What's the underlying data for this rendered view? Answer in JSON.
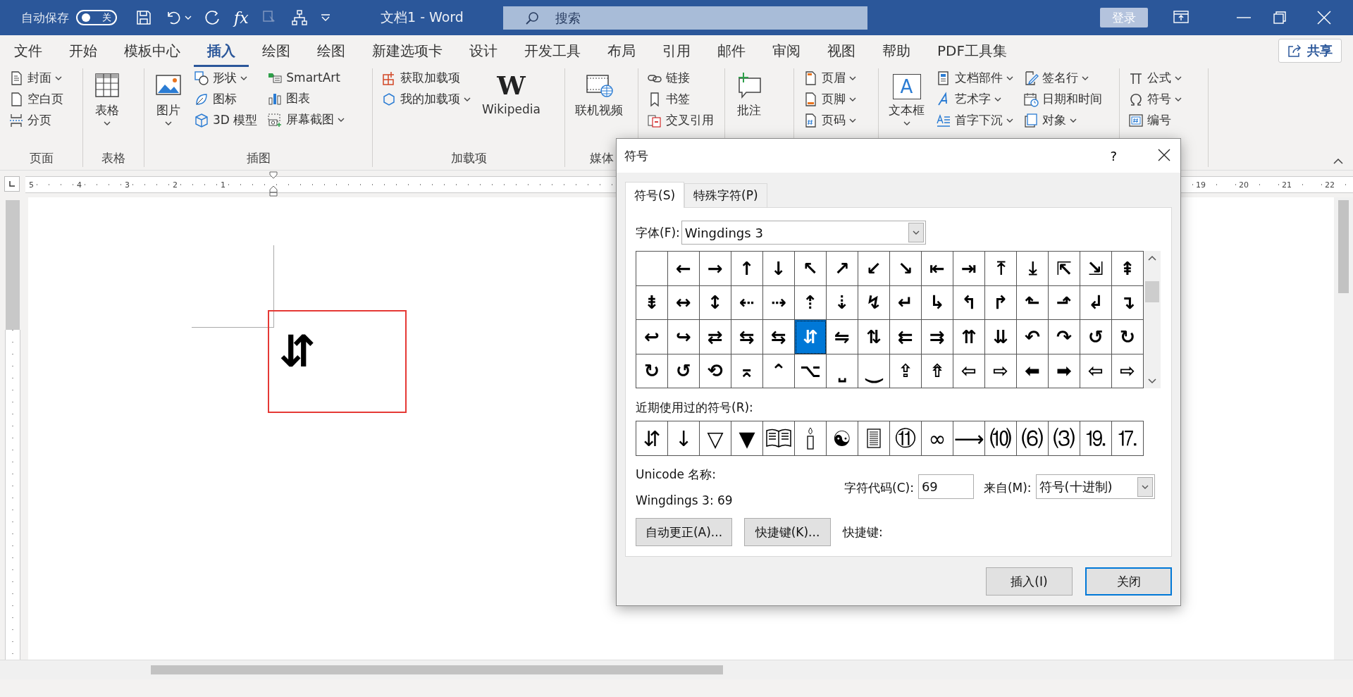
{
  "title_bar": {
    "autosave_label": "自动保存",
    "autosave_toggle": {
      "on": false,
      "label": "关"
    },
    "formula_button": "fx",
    "document_title": "文档1  -  Word",
    "search_placeholder": "搜索",
    "sign_in": "登录"
  },
  "ribbon_tabs": [
    {
      "label": "文件",
      "selected": false
    },
    {
      "label": "开始",
      "selected": false
    },
    {
      "label": "模板中心",
      "selected": false
    },
    {
      "label": "插入",
      "selected": true
    },
    {
      "label": "绘图",
      "selected": false
    },
    {
      "label": "绘图",
      "selected": false
    },
    {
      "label": "新建选项卡",
      "selected": false
    },
    {
      "label": "设计",
      "selected": false
    },
    {
      "label": "开发工具",
      "selected": false
    },
    {
      "label": "布局",
      "selected": false
    },
    {
      "label": "引用",
      "selected": false
    },
    {
      "label": "邮件",
      "selected": false
    },
    {
      "label": "审阅",
      "selected": false
    },
    {
      "label": "视图",
      "selected": false
    },
    {
      "label": "帮助",
      "selected": false
    },
    {
      "label": "PDF工具集",
      "selected": false
    }
  ],
  "share_button": "共享",
  "ribbon_groups": [
    {
      "label": "页面",
      "columns": [
        {
          "kind": "stack",
          "items": [
            {
              "label": "封面",
              "dropdown": true
            },
            {
              "label": "空白页",
              "dropdown": false
            },
            {
              "label": "分页",
              "dropdown": false
            }
          ]
        }
      ]
    },
    {
      "label": "表格",
      "columns": [
        {
          "kind": "large",
          "label": "表格",
          "dropdown": true
        }
      ]
    },
    {
      "label": "插图",
      "columns": [
        {
          "kind": "large",
          "label": "图片",
          "dropdown": true
        },
        {
          "kind": "stack",
          "items": [
            {
              "label": "形状",
              "dropdown": true
            },
            {
              "label": "图标",
              "dropdown": false
            },
            {
              "label": "3D 模型",
              "dropdown": false
            }
          ]
        },
        {
          "kind": "stack",
          "items": [
            {
              "label": "SmartArt",
              "dropdown": false
            },
            {
              "label": "图表",
              "dropdown": false
            },
            {
              "label": "屏幕截图",
              "dropdown": true
            }
          ]
        }
      ]
    },
    {
      "label": "加载项",
      "columns": [
        {
          "kind": "stack",
          "items": [
            {
              "label": "获取加载项",
              "dropdown": false
            },
            {
              "label": "我的加载项",
              "dropdown": true
            }
          ]
        },
        {
          "kind": "large",
          "label": "Wikipedia",
          "dropdown": false,
          "icon_text": "W"
        }
      ]
    },
    {
      "label": "媒体",
      "columns": [
        {
          "kind": "large",
          "label": "联机视频",
          "dropdown": false
        }
      ]
    },
    {
      "columns": [
        {
          "kind": "stack",
          "items": [
            {
              "label": "链接",
              "dropdown": false
            },
            {
              "label": "书签",
              "dropdown": false
            },
            {
              "label": "交叉引用",
              "dropdown": false
            }
          ]
        }
      ]
    },
    {
      "columns": [
        {
          "kind": "large",
          "label": "批注",
          "dropdown": false
        }
      ]
    },
    {
      "columns": [
        {
          "kind": "stack",
          "items": [
            {
              "label": "页眉",
              "dropdown": true
            },
            {
              "label": "页脚",
              "dropdown": true
            },
            {
              "label": "页码",
              "dropdown": true
            }
          ]
        }
      ]
    },
    {
      "columns": [
        {
          "kind": "large",
          "label": "文本框",
          "dropdown": true,
          "icon_text": "A"
        },
        {
          "kind": "stack",
          "items": [
            {
              "label": "文档部件",
              "dropdown": true
            },
            {
              "label": "艺术字",
              "dropdown": true
            },
            {
              "label": "首字下沉",
              "dropdown": true
            }
          ]
        },
        {
          "kind": "stack",
          "items": [
            {
              "label": "签名行",
              "dropdown": true
            },
            {
              "label": "日期和时间",
              "dropdown": false
            },
            {
              "label": "对象",
              "dropdown": true
            }
          ]
        }
      ]
    },
    {
      "columns": [
        {
          "kind": "stack",
          "items": [
            {
              "label": "公式",
              "dropdown": true
            },
            {
              "label": "符号",
              "dropdown": true
            },
            {
              "label": "编号",
              "dropdown": false
            }
          ]
        }
      ]
    }
  ],
  "ruler": {
    "left_numbers": [
      "5",
      "4",
      "3",
      "2",
      "1"
    ],
    "right_numbers": [
      "19",
      "20",
      "21",
      "22"
    ]
  },
  "document": {
    "inserted_symbol": "⇵"
  },
  "symbol_dialog": {
    "title": "符号",
    "help": "?",
    "tabs": [
      {
        "label": "符号(S)",
        "selected": true
      },
      {
        "label": "特殊字符(P)",
        "selected": false
      }
    ],
    "font_label": "字体(F):",
    "font_value": "Wingdings 3",
    "symbols": [
      {
        "selected": false
      },
      {
        "char": "←",
        "selected": false
      },
      {
        "char": "→",
        "selected": false
      },
      {
        "char": "↑",
        "selected": false
      },
      {
        "char": "↓",
        "selected": false
      },
      {
        "char": "↖",
        "selected": false
      },
      {
        "char": "↗",
        "selected": false
      },
      {
        "char": "↙",
        "selected": false
      },
      {
        "char": "↘",
        "selected": false
      },
      {
        "char": "⇤",
        "selected": false
      },
      {
        "char": "⇥",
        "selected": false
      },
      {
        "char": "⤒",
        "selected": false
      },
      {
        "char": "⤓",
        "selected": false
      },
      {
        "char": "⇱",
        "selected": false
      },
      {
        "char": "⇲",
        "selected": false
      },
      {
        "char": "⇞",
        "selected": false
      },
      {
        "char": "⇟",
        "selected": false
      },
      {
        "char": "↔",
        "selected": false
      },
      {
        "char": "↕",
        "selected": false
      },
      {
        "char": "⇠",
        "selected": false
      },
      {
        "char": "⇢",
        "selected": false
      },
      {
        "char": "⇡",
        "selected": false
      },
      {
        "char": "⇣",
        "selected": false
      },
      {
        "char": "↯",
        "selected": false
      },
      {
        "char": "↵",
        "selected": false
      },
      {
        "char": "↳",
        "selected": false
      },
      {
        "char": "↰",
        "selected": false
      },
      {
        "char": "↱",
        "selected": false
      },
      {
        "char": "⬑",
        "selected": false
      },
      {
        "char": "⬏",
        "selected": false
      },
      {
        "char": "↲",
        "selected": false
      },
      {
        "char": "↴",
        "selected": false
      },
      {
        "char": "↩",
        "selected": false
      },
      {
        "char": "↪",
        "selected": false
      },
      {
        "char": "⇄",
        "selected": false
      },
      {
        "char": "⇆",
        "selected": false
      },
      {
        "char": "⇆",
        "selected": false
      },
      {
        "char": "⇵",
        "selected": true
      },
      {
        "char": "⇋",
        "selected": false
      },
      {
        "char": "⇅",
        "selected": false
      },
      {
        "char": "⇇",
        "selected": false
      },
      {
        "char": "⇉",
        "selected": false
      },
      {
        "char": "⇈",
        "selected": false
      },
      {
        "char": "⇊",
        "selected": false
      },
      {
        "char": "↶",
        "selected": false
      },
      {
        "char": "↷",
        "selected": false
      },
      {
        "char": "↺",
        "selected": false
      },
      {
        "char": "↻",
        "selected": false
      },
      {
        "char": "↻",
        "selected": false
      },
      {
        "char": "↺",
        "selected": false
      },
      {
        "char": "⟲",
        "selected": false
      },
      {
        "char": "⌅",
        "selected": false
      },
      {
        "char": "⌃",
        "selected": false
      },
      {
        "char": "⌥",
        "selected": false
      },
      {
        "char": "⎵",
        "selected": false
      },
      {
        "char": "⏝",
        "selected": false
      },
      {
        "char": "⇪",
        "selected": false
      },
      {
        "char": "⇮",
        "selected": false
      },
      {
        "char": "⇦",
        "selected": false
      },
      {
        "char": "⇨",
        "selected": false
      },
      {
        "char": "⬅",
        "selected": false
      },
      {
        "char": "➡",
        "selected": false
      },
      {
        "char": "⇦",
        "selected": false
      },
      {
        "char": "⇨",
        "selected": false
      }
    ],
    "recent_label": "近期使用过的符号(R):",
    "recent": [
      {
        "kind": "char",
        "char": "⇵"
      },
      {
        "kind": "char",
        "char": "↓"
      },
      {
        "kind": "char",
        "char": "▽"
      },
      {
        "kind": "char",
        "char": "▼"
      },
      {
        "kind": "book"
      },
      {
        "kind": "candle"
      },
      {
        "kind": "char",
        "char": "☯"
      },
      {
        "kind": "page"
      },
      {
        "kind": "char",
        "char": "⑪"
      },
      {
        "kind": "char",
        "char": "∞"
      },
      {
        "kind": "char",
        "char": "⟶"
      },
      {
        "kind": "char",
        "char": "⑽"
      },
      {
        "kind": "char",
        "char": "⑹"
      },
      {
        "kind": "char",
        "char": "⑶"
      },
      {
        "kind": "char",
        "char": "⒚"
      },
      {
        "kind": "char",
        "char": "⒘"
      }
    ],
    "unicode_name_label": "Unicode 名称:",
    "unicode_name": "Wingdings 3: 69",
    "char_code_label": "字符代码(C):",
    "char_code": "69",
    "from_label": "来自(M):",
    "from_value": "符号(十进制)",
    "autocorrect_button": "自动更正(A)...",
    "shortcut_button": "快捷键(K)...",
    "shortcut_label": "快捷键:",
    "footer_buttons": [
      {
        "label": "插入(I)",
        "default": false
      },
      {
        "label": "关闭",
        "default": true
      }
    ]
  }
}
